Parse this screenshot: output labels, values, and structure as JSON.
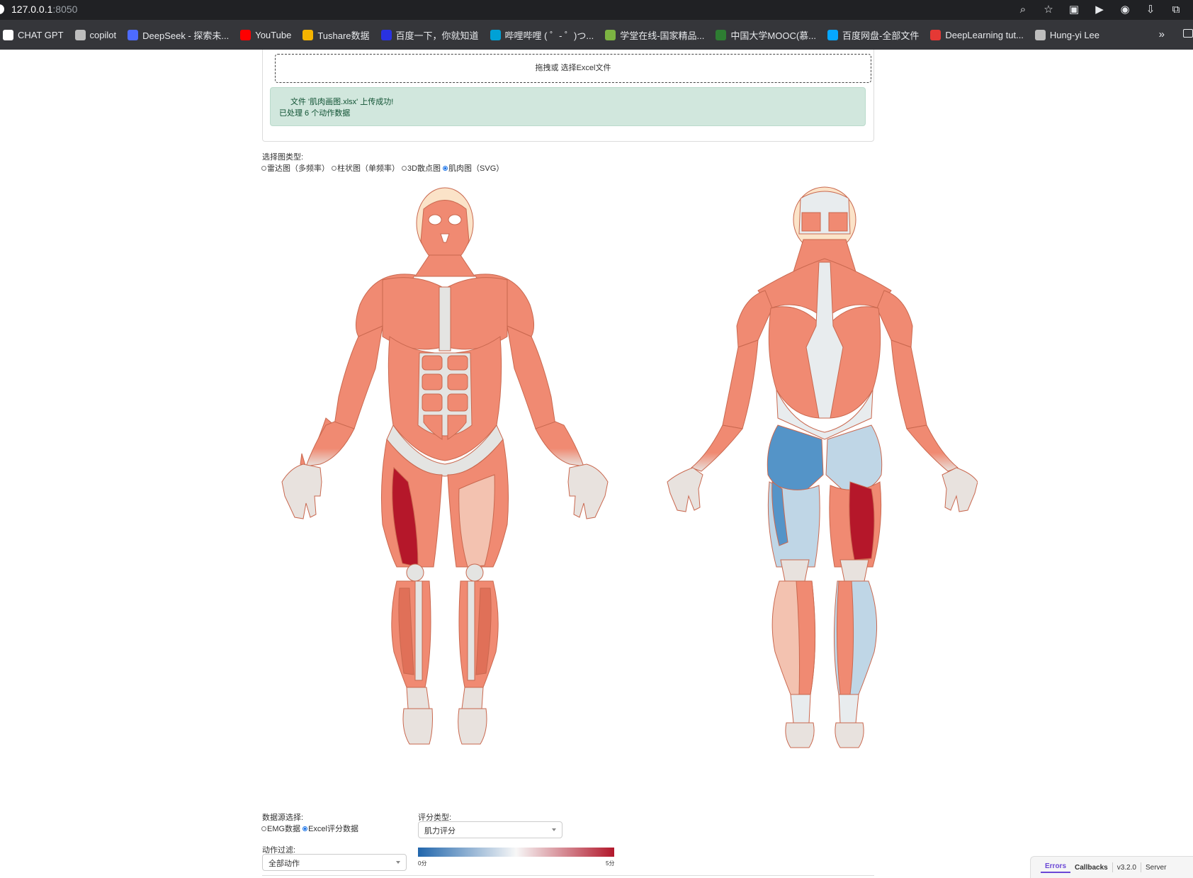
{
  "browser": {
    "url_host": "127.0.0.1",
    "url_port": ":8050",
    "bookmarks": [
      {
        "label": "CHAT GPT",
        "color": "#ffffff"
      },
      {
        "label": "copilot",
        "color": "#bdbdbd"
      },
      {
        "label": "DeepSeek - 探索未...",
        "color": "#4d6bfe"
      },
      {
        "label": "YouTube",
        "color": "#ff0000"
      },
      {
        "label": "Tushare数据",
        "color": "#f5b400"
      },
      {
        "label": "百度一下，你就知道",
        "color": "#2932e1"
      },
      {
        "label": "哔哩哔哩 ( ゜- ゜)つ...",
        "color": "#00a1d6"
      },
      {
        "label": "学堂在线-国家精品...",
        "color": "#7cb342"
      },
      {
        "label": "中国大学MOOC(慕...",
        "color": "#2e7d32"
      },
      {
        "label": "百度网盘-全部文件",
        "color": "#06a7ff"
      },
      {
        "label": "DeepLearning tut...",
        "color": "#e53935"
      },
      {
        "label": "Hung-yi Lee",
        "color": "#bdbdbd"
      }
    ],
    "more_label": "»"
  },
  "upload": {
    "dropzone_text": "拖拽或 选择Excel文件",
    "alert_line1": "文件 '肌肉画图.xlsx' 上传成功!",
    "alert_line2": "已处理 6 个动作数据"
  },
  "chart_type": {
    "label": "选择图类型:",
    "options": [
      "雷达图（多频率）",
      "柱状图（单频率）",
      "3D散点图",
      "肌肉图（SVG）"
    ],
    "selected_index": 3
  },
  "muscle_map": {
    "views": [
      "front",
      "back"
    ],
    "colors": {
      "base": "#f08a72",
      "highlight_high": "#b5172a",
      "highlight_low_back": "#5494c8",
      "highlight_light_blue": "#bfd6e6",
      "highlight_light_red": "#f3c2b0",
      "tendon": "#e4e4e2",
      "skull": "#fbe3c8"
    }
  },
  "data_source": {
    "label": "数据源选择:",
    "options": [
      "EMG数据",
      "Excel评分数据"
    ],
    "selected_index": 1
  },
  "score_type": {
    "label": "评分类型:",
    "value": "肌力评分"
  },
  "action_filter": {
    "label": "动作过滤:",
    "value": "全部动作"
  },
  "colorbar": {
    "min_label": "0分",
    "max_label": "5分",
    "colors": [
      "#2166ac",
      "#f7f7f7",
      "#b2182b"
    ]
  },
  "devtools": {
    "errors": "Errors",
    "callbacks": "Callbacks",
    "version": "v3.2.0",
    "server": "Server"
  }
}
